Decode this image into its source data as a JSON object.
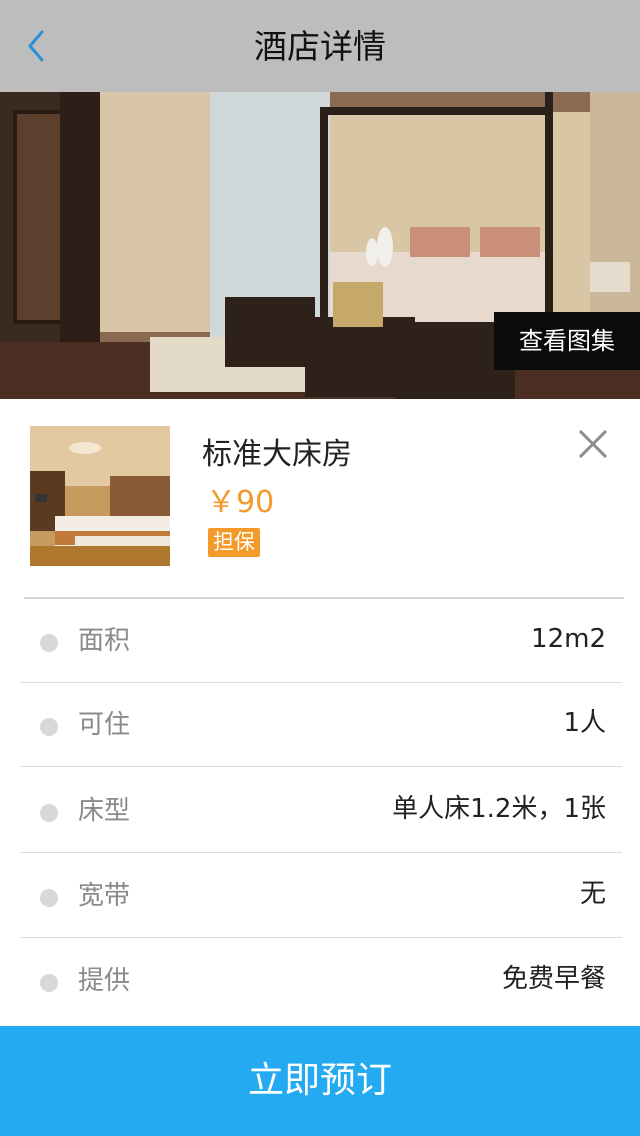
{
  "nav": {
    "title": "酒店详情",
    "back_icon": "chevron-left-icon"
  },
  "hero": {
    "gallery_label": "查看图集"
  },
  "room": {
    "name": "标准大床房",
    "price": "￥90",
    "badge": "担保",
    "close_icon": "close-icon"
  },
  "specs": [
    {
      "label": "面积",
      "value": "12m2"
    },
    {
      "label": "可住",
      "value": "1人"
    },
    {
      "label": "床型",
      "value": "单人床1.2米，1张"
    },
    {
      "label": "宽带",
      "value": "无"
    },
    {
      "label": "提供",
      "value": "免费早餐"
    }
  ],
  "footer": {
    "book_label": "立即预订"
  },
  "colors": {
    "nav_bg": "#bdbdbd",
    "accent_blue": "#23aaf0",
    "price_orange": "#f39a2b"
  }
}
